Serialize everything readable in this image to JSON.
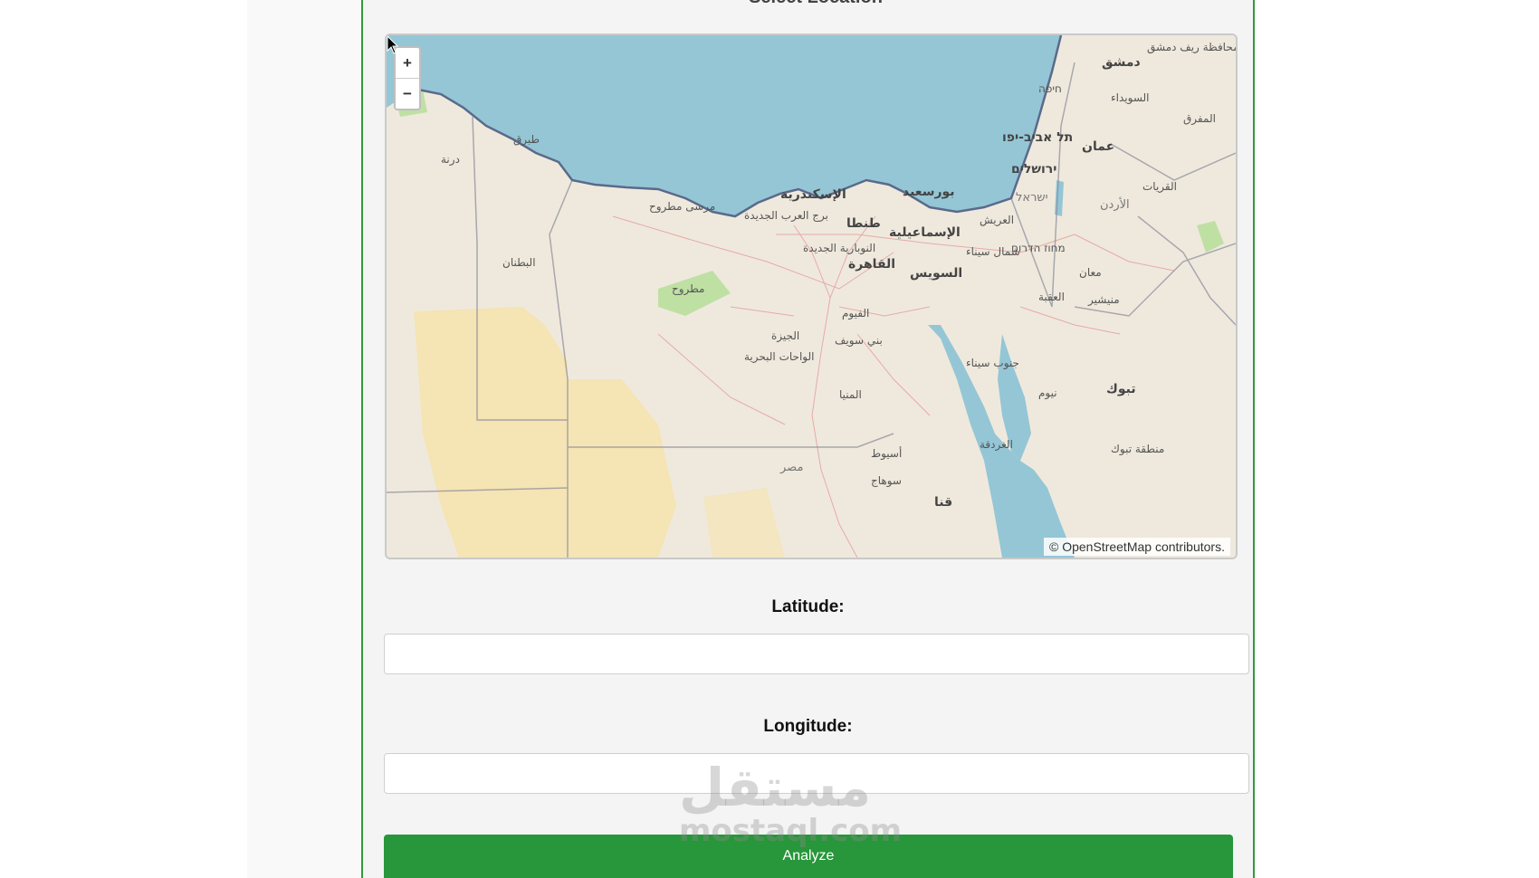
{
  "form": {
    "title_partial": "Select Location",
    "latitude_label": "Latitude:",
    "latitude_value": "",
    "longitude_label": "Longitude:",
    "longitude_value": "",
    "analyze_label": "Analyze"
  },
  "map": {
    "zoom_in": "+",
    "zoom_out": "−",
    "attribution_symbol": "©",
    "attribution_link": "OpenStreetMap",
    "attribution_suffix": " contributors.",
    "labels": {
      "damascus": "دمشق",
      "rif_damascus": "محافظة ريف دمشق",
      "haifa": "חיפה",
      "sweida": "السويداء",
      "tel_aviv": "תל אביב-יפו",
      "amman": "عمان",
      "mafraq": "المفرق",
      "jerusalem": "ירושלים",
      "israel": "ישראל",
      "jordan": "الأردن",
      "qurayyat": "القريات",
      "tobruk": "طبرق",
      "derna": "درنة",
      "marsa_matruh": "مرسى مطروح",
      "alexandria": "الإسكندرية",
      "port_said": "بورسعيد",
      "tanta": "طنطا",
      "ismailia": "الإسماعيلية",
      "arish": "العريش",
      "north_sinai": "شمال سيناء",
      "cairo": "القاهرة",
      "suez": "السويس",
      "butnan": "البطنان",
      "matruh": "مطروح",
      "borg_el_arab": "برج العرب الجديدة",
      "nubariya": "النوبارية الجديدة",
      "fayoum": "الفيوم",
      "giza": "الجيزة",
      "beni_suef": "بني سويف",
      "wahat": "الواحات البحرية",
      "minya": "المنيا",
      "south_sinai": "جنوب سيناء",
      "aqaba": "العقبة",
      "maan": "معان",
      "tabuk": "تبوك",
      "tabuk_region": "منطقة تبوك",
      "neom": "نيوم",
      "hurghada": "الغردقة",
      "asyut": "أسيوط",
      "sohag": "سوهاج",
      "qena": "قنا",
      "egypt": "مصر",
      "mitzpe": "מחוז הדרום",
      "mansheya": "منيشير"
    }
  },
  "watermark": {
    "arabic": "مستقل",
    "latin": "mostaql.com"
  },
  "colors": {
    "accent_green": "#28963a",
    "border_green": "#2f9b3b",
    "sea": "#94c6d6",
    "land": "#efe9dd",
    "desert": "#f5e4b4"
  }
}
